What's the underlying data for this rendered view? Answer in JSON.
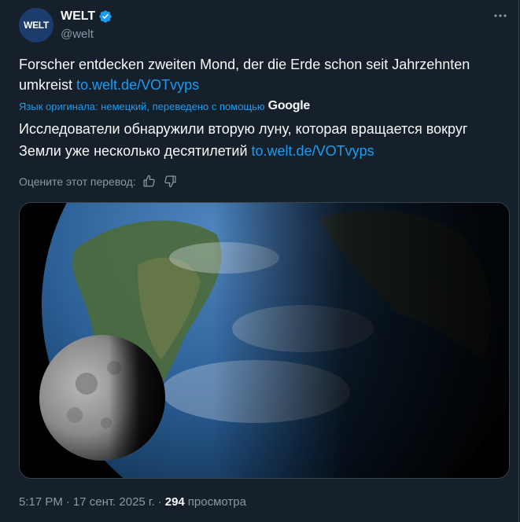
{
  "author": {
    "avatar_text": "WELT",
    "name": "WELT",
    "handle": "@welt"
  },
  "tweet": {
    "text": "Forscher entdecken zweiten Mond, der die Erde schon seit Jahrzehnten umkreist",
    "link": "to.welt.de/VOTvyps"
  },
  "translation": {
    "note": "Язык оригинала: немецкий, переведено с помощью",
    "provider": "Google",
    "text": "Исследователи обнаружили вторую луну, которая вращается вокруг Земли уже несколько десятилетий",
    "link": "to.welt.de/VOTvyps",
    "rate_label": "Оцените этот перевод:"
  },
  "meta": {
    "time": "5:17 PM",
    "separator1": "·",
    "date": "17 сент. 2025 г.",
    "separator2": "·",
    "views_count": "294",
    "views_label": "просмотра"
  },
  "colors": {
    "background": "#15202b",
    "link": "#1d9bf0",
    "secondary_text": "#8b98a5",
    "verified": "#1d9bf0"
  },
  "icons": [
    "verified-badge-icon",
    "more-options-icon",
    "thumbs-up-icon",
    "thumbs-down-icon"
  ]
}
